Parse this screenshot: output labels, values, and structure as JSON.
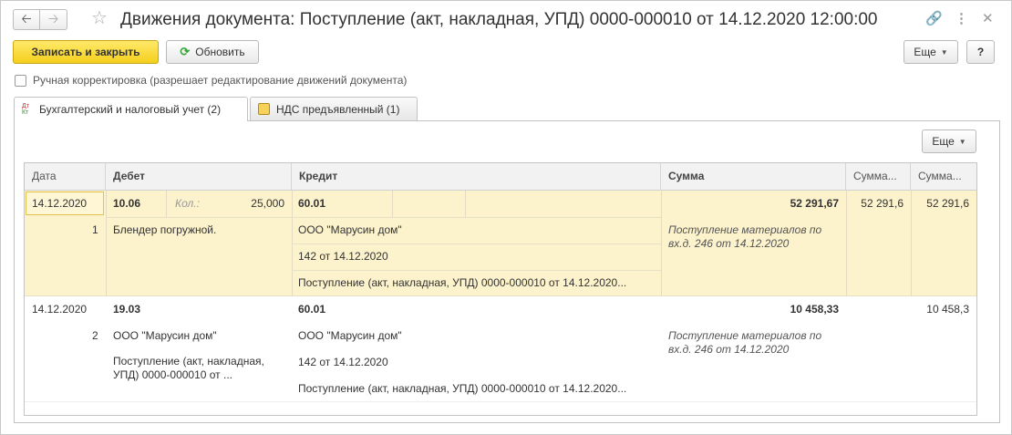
{
  "window": {
    "title": "Движения документа: Поступление (акт, накладная, УПД) 0000-000010 от 14.12.2020 12:00:00",
    "icons": {
      "back": "arrow-left-icon",
      "forward": "arrow-right-icon",
      "favorite": "star-icon",
      "link": "link-icon",
      "menu": "kebab-menu-icon",
      "close": "close-icon"
    }
  },
  "toolbar": {
    "save_close": "Записать и закрыть",
    "refresh": "Обновить",
    "more": "Еще",
    "help": "?"
  },
  "manual_edit": {
    "label": "Ручная корректировка (разрешает редактирование движений документа)",
    "checked": false
  },
  "tabs": [
    {
      "label": "Бухгалтерский и налоговый учет (2)",
      "icon": "dt-kt-icon",
      "active": true
    },
    {
      "label": "НДС предъявленный (1)",
      "icon": "vat-icon",
      "active": false
    }
  ],
  "panel": {
    "more": "Еще"
  },
  "table": {
    "columns": [
      "Дата",
      "Дебет",
      "Кредит",
      "Сумма",
      "Сумма...",
      "Сумма..."
    ],
    "rows": [
      {
        "date": "14.12.2020",
        "num": "1",
        "debit_account": "10.06",
        "qty_label": "Кол.:",
        "qty": "25,000",
        "debit_sub1": "Блендер погружной.",
        "credit_account": "60.01",
        "credit_sub1": "ООО \"Марусин дом\"",
        "credit_sub2": "142 от 14.12.2020",
        "credit_sub3": "Поступление (акт, накладная, УПД) 0000-000010 от 14.12.2020...",
        "sum": "52 291,67",
        "content": "Поступление материалов по вх.д. 246 от 14.12.2020",
        "sum_nu": "52 291,6",
        "sum_vr": "52 291,6"
      },
      {
        "date": "14.12.2020",
        "num": "2",
        "debit_account": "19.03",
        "debit_sub1": "ООО \"Марусин дом\"",
        "debit_sub2": "Поступление (акт, накладная, УПД) 0000-000010 от ...",
        "credit_account": "60.01",
        "credit_sub1": "ООО \"Марусин дом\"",
        "credit_sub2": "142 от 14.12.2020",
        "credit_sub3": "Поступление (акт, накладная, УПД) 0000-000010 от 14.12.2020...",
        "sum": "10 458,33",
        "content": "Поступление материалов по вх.д. 246 от 14.12.2020",
        "sum_nu": "",
        "sum_vr": "10 458,3"
      }
    ]
  }
}
